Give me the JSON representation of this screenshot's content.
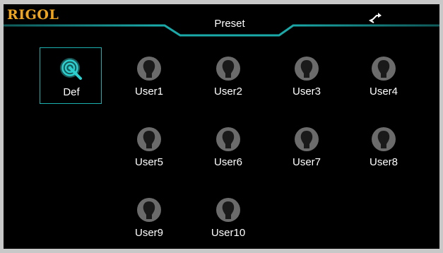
{
  "header": {
    "logo": "RIGOL",
    "title": "Preset",
    "accent_color": "#1aa9a9",
    "logo_color": "#f1a51b",
    "status_icon": "sync-arrows-icon"
  },
  "presets": [
    {
      "label": "Def",
      "icon": "target-probe-icon",
      "selected": true
    },
    {
      "label": "User1",
      "icon": "user-head-icon",
      "selected": false
    },
    {
      "label": "User2",
      "icon": "user-head-icon",
      "selected": false
    },
    {
      "label": "User3",
      "icon": "user-head-icon",
      "selected": false
    },
    {
      "label": "User4",
      "icon": "user-head-icon",
      "selected": false
    },
    {
      "label": "User5",
      "icon": "user-head-icon",
      "selected": false
    },
    {
      "label": "User6",
      "icon": "user-head-icon",
      "selected": false
    },
    {
      "label": "User7",
      "icon": "user-head-icon",
      "selected": false
    },
    {
      "label": "User8",
      "icon": "user-head-icon",
      "selected": false
    },
    {
      "label": "User9",
      "icon": "user-head-icon",
      "selected": false
    },
    {
      "label": "User10",
      "icon": "user-head-icon",
      "selected": false
    }
  ]
}
